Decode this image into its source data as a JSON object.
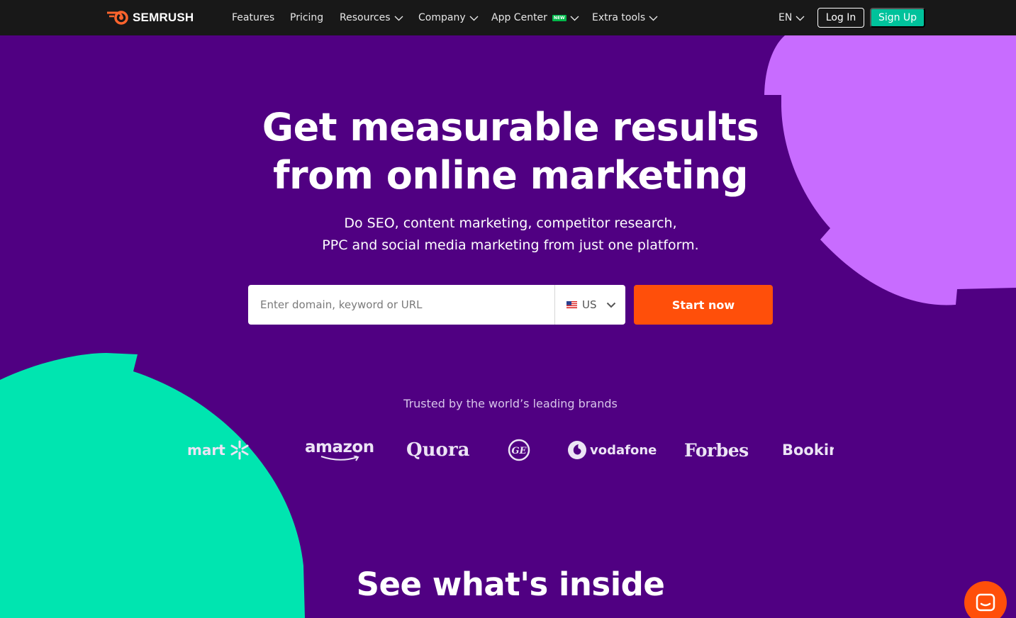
{
  "header": {
    "logo_text": "SEMRUSH",
    "nav": [
      {
        "label": "Features"
      },
      {
        "label": "Pricing"
      },
      {
        "label": "Resources"
      },
      {
        "label": "Company"
      },
      {
        "label": "App Center",
        "badge": "NEW"
      },
      {
        "label": "Extra tools"
      }
    ],
    "language": "EN",
    "login_label": "Log In",
    "signup_label": "Sign Up"
  },
  "hero": {
    "title_line1": "Get measurable results",
    "title_line2": "from online marketing",
    "subtitle_line1": "Do SEO, content marketing, competitor research,",
    "subtitle_line2": "PPC and social media marketing from just one platform.",
    "search_placeholder": "Enter domain, keyword or URL",
    "database_value": "US",
    "cta_label": "Start now"
  },
  "brands": {
    "heading": "Trusted by the world’s leading brands",
    "logos": [
      {
        "name": "mart",
        "icon": "walmart-spark-icon"
      },
      {
        "name": "amazon"
      },
      {
        "name": "Quora"
      },
      {
        "name": "GE",
        "icon": "ge-monogram-icon"
      },
      {
        "name": "vodafone",
        "icon": "vodafone-speechmark-icon"
      },
      {
        "name": "Forbes"
      },
      {
        "name": "Bookin"
      }
    ]
  },
  "section": {
    "title": "See what's inside"
  },
  "colors": {
    "background": "#500082",
    "topbar": "#181818",
    "accent_orange": "#ff4f0a",
    "accent_green": "#00c29b",
    "blob_lilac": "#c86cff",
    "blob_mint": "#00e5b0"
  }
}
